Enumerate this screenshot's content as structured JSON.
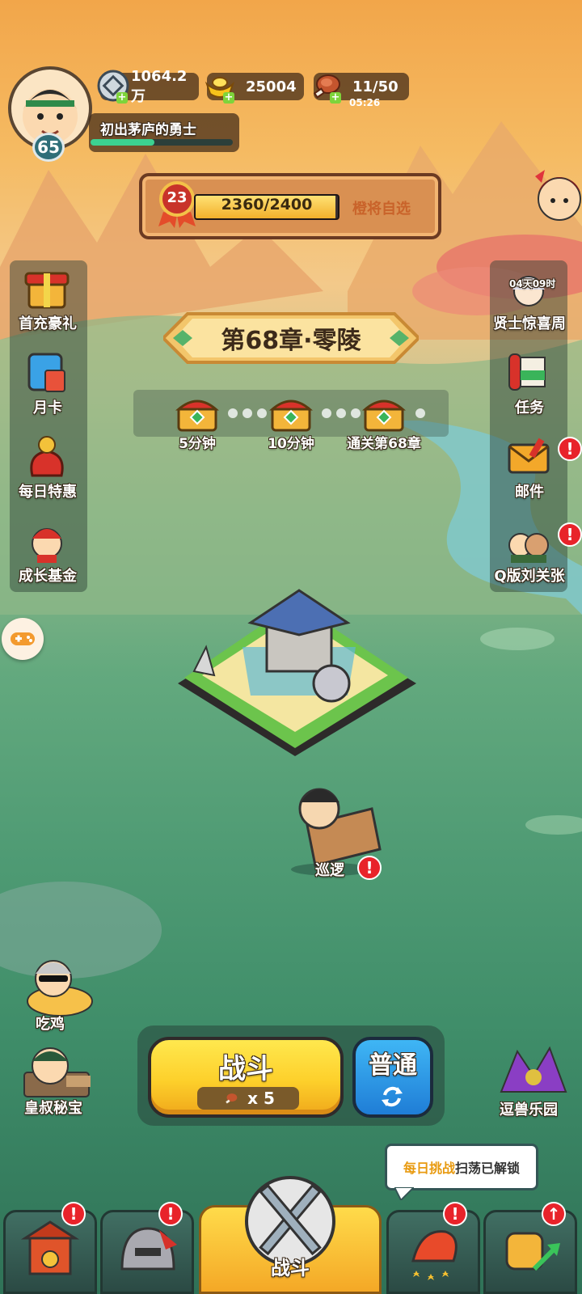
{
  "player": {
    "level": "65",
    "title": "初出茅庐的勇士",
    "exp_fraction": 0.45
  },
  "resources": {
    "silver": "1064.2万",
    "gold": "25004",
    "stamina": "11/50",
    "stamina_timer": "05:26"
  },
  "task_bar": {
    "level": "23",
    "progress_text": "2360/2400",
    "progress_fraction": 0.983,
    "action_label": "橙将自选"
  },
  "chapter": {
    "title": "第68章·零陵",
    "rewards": [
      {
        "label": "5分钟",
        "icon": "treasure-chest-icon"
      },
      {
        "label": "10分钟",
        "icon": "treasure-chest-icon"
      },
      {
        "label": "通关第68章",
        "icon": "treasure-chest-icon"
      }
    ]
  },
  "left_menu": [
    {
      "label": "首充豪礼",
      "icon": "gift-chest-icon"
    },
    {
      "label": "月卡",
      "icon": "month-card-icon"
    },
    {
      "label": "每日特惠",
      "icon": "money-bag-icon"
    },
    {
      "label": "成长基金",
      "icon": "fortune-god-icon"
    }
  ],
  "right_menu": [
    {
      "label": "贤士惊喜周",
      "icon": "sage-girl-icon",
      "timer": "04天09时"
    },
    {
      "label": "任务",
      "icon": "scroll-icon"
    },
    {
      "label": "邮件",
      "icon": "mail-icon",
      "alert": "!"
    },
    {
      "label": "Q版刘关张",
      "icon": "q-heroes-icon",
      "alert": "!"
    }
  ],
  "patrol": {
    "label": "巡逻",
    "alert": "!"
  },
  "bottom_left": [
    {
      "label": "吃鸡",
      "icon": "chicken-hero-icon"
    },
    {
      "label": "皇叔秘宝",
      "icon": "uncle-treasure-icon"
    }
  ],
  "bottom_right": {
    "label": "逗兽乐园",
    "icon": "beast-park-icon"
  },
  "battle": {
    "fight_label": "战斗",
    "cost_text": "x 5",
    "mode_label": "普通"
  },
  "tooltip": {
    "highlight": "每日挑战",
    "rest": "扫荡已解锁"
  },
  "nav": {
    "center_label": "战斗",
    "alert": "!",
    "upgrade": "↑"
  },
  "colors": {
    "accent_gold": "#fdd02b",
    "alert_red": "#e8232a",
    "mode_blue": "#1f7dd6"
  }
}
